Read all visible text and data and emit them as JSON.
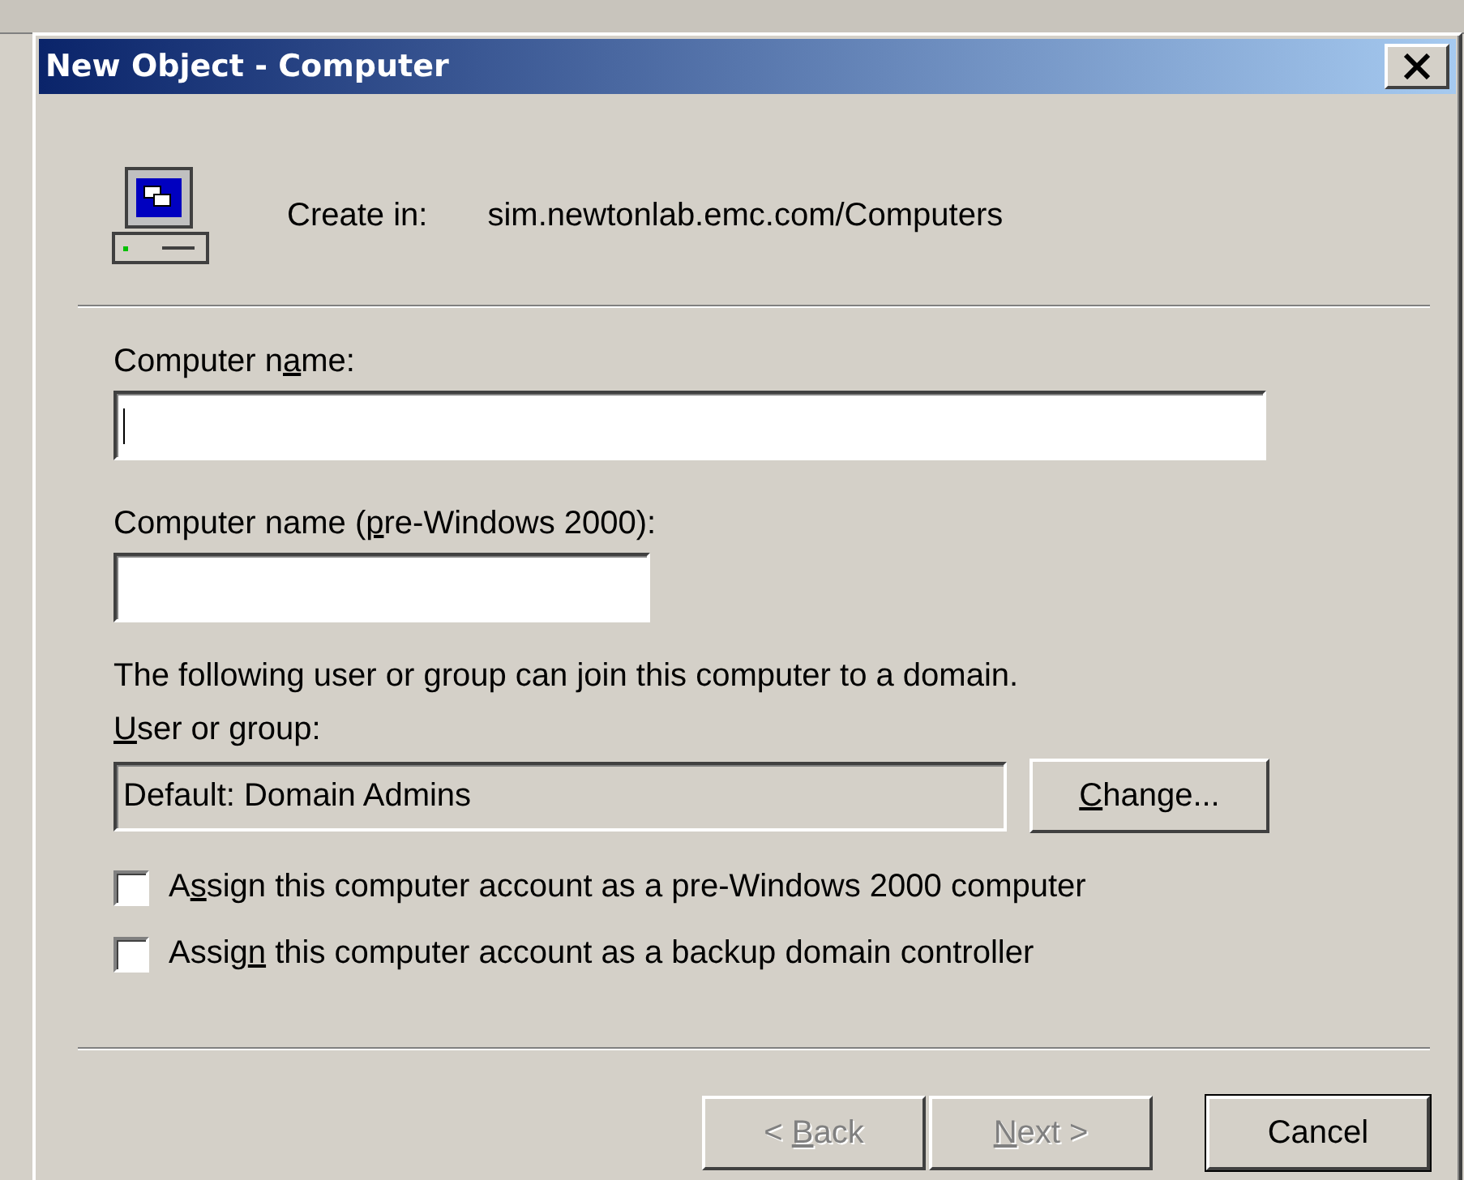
{
  "window": {
    "title": "New Object - Computer"
  },
  "header": {
    "label": "Create in:",
    "path": "sim.newtonlab.emc.com/Computers"
  },
  "fields": [
    {
      "label": {
        "before": "Computer n",
        "key": "a",
        "after": "me:"
      },
      "kind": "wide",
      "focused": true
    },
    {
      "label": {
        "before": "Computer name (",
        "key": "p",
        "after": "re-Windows 2000):"
      },
      "kind": "narrow",
      "focused": false
    }
  ],
  "note": "The following user or group can join this computer to a domain.",
  "user_group": {
    "label": {
      "key": "U",
      "after": "ser or group:"
    },
    "value": "Default: Domain Admins",
    "button": {
      "key": "C",
      "after": "hange..."
    }
  },
  "options": [
    {
      "label": {
        "before": "A",
        "key": "s",
        "after": "sign this computer account as a pre-Windows 2000 computer"
      },
      "checked": false
    },
    {
      "label": {
        "before": "Assig",
        "key": "n",
        "after": " this computer account as a backup domain controller"
      },
      "checked": false
    }
  ],
  "buttons": [
    {
      "label": {
        "before": "< ",
        "key": "B",
        "after": "ack"
      },
      "disabled": true,
      "default": false
    },
    {
      "label": {
        "key": "N",
        "after": "ext >"
      },
      "disabled": true,
      "default": false
    },
    {
      "label": {
        "before": "Cancel"
      },
      "disabled": false,
      "default": true
    }
  ]
}
